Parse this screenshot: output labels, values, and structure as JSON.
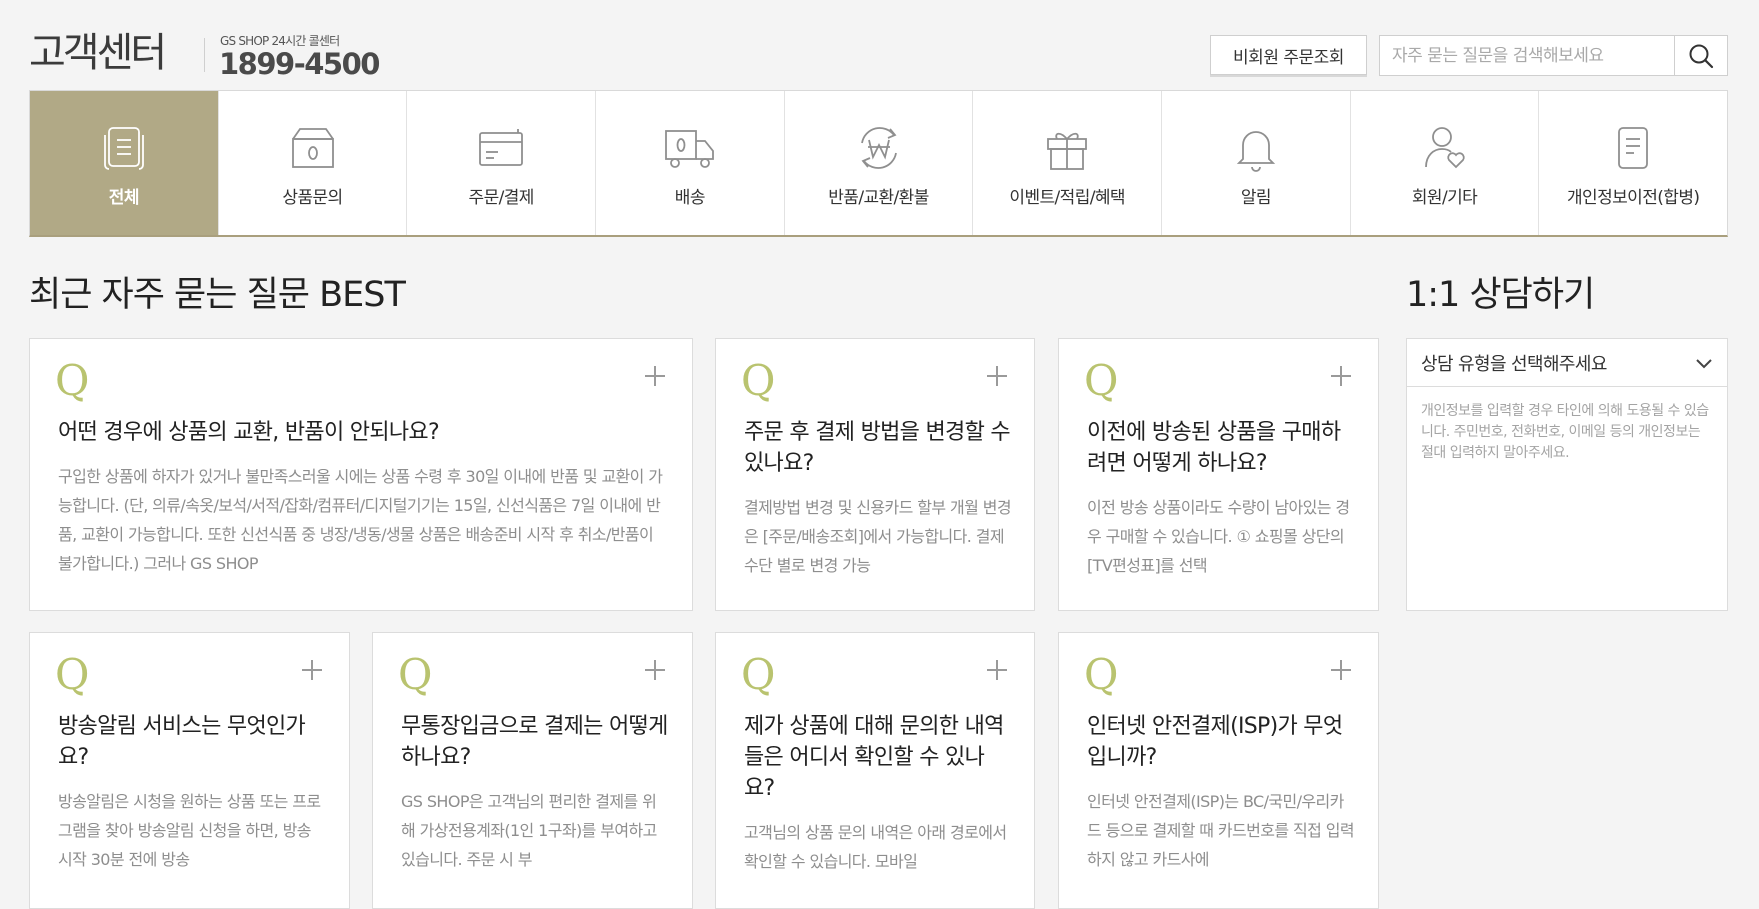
{
  "header": {
    "title": "고객센터",
    "subtitle": "GS SHOP 24시간 콜센터",
    "phone": "1899-4500",
    "guest_order_label": "비회원 주문조회",
    "search_placeholder": "자주 묻는 질문을 검색해보세요"
  },
  "categories": [
    {
      "label": "전체",
      "icon": "document-list-icon",
      "active": true
    },
    {
      "label": "상품문의",
      "icon": "box-icon"
    },
    {
      "label": "주문/결제",
      "icon": "card-icon"
    },
    {
      "label": "배송",
      "icon": "truck-icon"
    },
    {
      "label": "반품/교환/환불",
      "icon": "won-refresh-icon"
    },
    {
      "label": "이벤트/적립/혜택",
      "icon": "gift-icon"
    },
    {
      "label": "알림",
      "icon": "bell-icon"
    },
    {
      "label": "회원/기타",
      "icon": "user-heart-icon"
    },
    {
      "label": "개인정보이전(합병)",
      "icon": "document-icon"
    }
  ],
  "faq": {
    "title": "최근 자주 묻는 질문 BEST",
    "q_mark": "Q",
    "items": [
      {
        "title": "어떤 경우에 상품의 교환, 반품이 안되나요?",
        "body": "구입한 상품에 하자가 있거나 불만족스러울 시에는 상품 수령 후 30일 이내에 반품 및 교환이 가능합니다. (단, 의류/속옷/보석/서적/잡화/컴퓨터/디지털기기는 15일, 신선식품은 7일 이내에 반품, 교환이 가능합니다. 또한 신선식품 중 냉장/냉동/생물 상품은 배송준비 시작 후 취소/반품이 불가합니다.) 그러나 GS SHOP"
      },
      {
        "title": "주문 후 결제 방법을 변경할 수 있나요?",
        "body": "결제방법 변경 및 신용카드 할부 개월 변경은 [주문/배송조회]에서 가능합니다. 결제수단 별로 변경 가능"
      },
      {
        "title": "이전에 방송된 상품을 구매하려면 어떻게 하나요?",
        "body": "이전 방송 상품이라도 수량이 남아있는 경우 구매할 수 있습니다. ① 쇼핑몰 상단의 [TV편성표]를 선택"
      },
      {
        "title": "방송알림 서비스는 무엇인가요?",
        "body": "방송알림은 시청을 원하는 상품 또는 프로그램을 찾아 방송알림 신청을 하면, 방송 시작 30분 전에 방송"
      },
      {
        "title": "무통장입금으로 결제는 어떻게 하나요?",
        "body": "GS SHOP은 고객님의 편리한 결제를 위해 가상전용계좌(1인 1구좌)를 부여하고 있습니다. 주문 시 부"
      },
      {
        "title": "제가 상품에 대해 문의한 내역들은 어디서 확인할 수 있나요?",
        "body": "고객님의 상품 문의 내역은 아래 경로에서 확인할 수 있습니다. 모바일"
      },
      {
        "title": "인터넷 안전결제(ISP)가 무엇입니까?",
        "body": "인터넷 안전결제(ISP)는 BC/국민/우리카드 등으로 결제할 때 카드번호를 직접 입력하지 않고 카드사에"
      }
    ]
  },
  "consult": {
    "title": "1:1 상담하기",
    "select_label": "상담 유형을 선택해주세요",
    "note": "개인정보를 입력할 경우 타인에 의해 도용될 수 있습니다. 주민번호, 전화번호, 이메일 등의 개인정보는 절대 입력하지 말아주세요."
  },
  "colors": {
    "accent": "#b1a986",
    "q_mark": "#b9c36f",
    "background": "#f4f4f4"
  }
}
